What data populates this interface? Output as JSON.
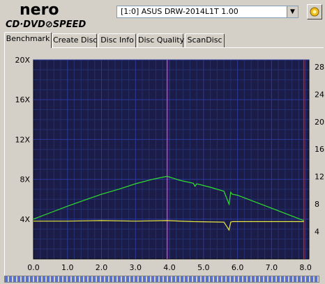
{
  "app": {
    "logo_top": "nero",
    "logo_bottom": "CD·DVD⊘SPEED",
    "device": "[1:0]  ASUS DRW-2014L1T 1.00",
    "icons": {
      "dropdown": "chevron-down-icon",
      "refresh": "refresh-icon"
    }
  },
  "tabs": [
    {
      "label": "Benchmark",
      "active": true
    },
    {
      "label": "Create Disc",
      "active": false
    },
    {
      "label": "Disc Info",
      "active": false
    },
    {
      "label": "Disc Quality",
      "active": false
    },
    {
      "label": "ScanDisc",
      "active": false
    }
  ],
  "chart_data": {
    "type": "line",
    "x_ticks": [
      "0.0",
      "1.0",
      "2.0",
      "3.0",
      "4.0",
      "5.0",
      "6.0",
      "7.0",
      "8.0"
    ],
    "y_left_ticks": [
      "20X",
      "16X",
      "12X",
      "8X",
      "4X"
    ],
    "y_left_values": [
      20,
      16,
      12,
      8,
      4
    ],
    "y_right_ticks": [
      "28",
      "24",
      "20",
      "16",
      "12",
      "8",
      "4"
    ],
    "y_right_values": [
      28,
      24,
      20,
      16,
      12,
      8,
      4
    ],
    "xlim": [
      0,
      8.1
    ],
    "ylim_left": [
      0,
      20
    ],
    "ylim_right": [
      0,
      29
    ],
    "grid": true,
    "markers": [
      {
        "x": 3.93,
        "color": "#d040d0"
      },
      {
        "x": 7.95,
        "color": "#c02020"
      }
    ],
    "colors": {
      "background": "#1c1c48",
      "grid": "#2a3a9c",
      "speed": "#30e030",
      "rpm": "#e8e840"
    },
    "series": [
      {
        "key": "speed",
        "x": [
          0.0,
          0.5,
          1.0,
          1.5,
          2.0,
          2.5,
          3.0,
          3.5,
          3.93,
          4.3,
          4.7,
          4.75,
          4.8,
          5.2,
          5.6,
          5.75,
          5.8,
          5.85,
          6.0,
          6.5,
          7.0,
          7.5,
          7.95
        ],
        "y": [
          4.0,
          4.65,
          5.3,
          5.9,
          6.5,
          7.0,
          7.55,
          8.0,
          8.3,
          7.9,
          7.6,
          7.3,
          7.55,
          7.2,
          6.8,
          5.5,
          6.7,
          6.5,
          6.4,
          5.75,
          5.1,
          4.45,
          3.85
        ]
      },
      {
        "key": "rpm",
        "x": [
          0.0,
          1.0,
          2.0,
          3.0,
          3.93,
          4.7,
          5.6,
          5.75,
          5.8,
          5.85,
          6.5,
          7.5,
          7.95
        ],
        "y": [
          3.8,
          3.8,
          3.85,
          3.8,
          3.85,
          3.75,
          3.7,
          2.9,
          3.7,
          3.75,
          3.75,
          3.75,
          3.75
        ]
      }
    ]
  }
}
